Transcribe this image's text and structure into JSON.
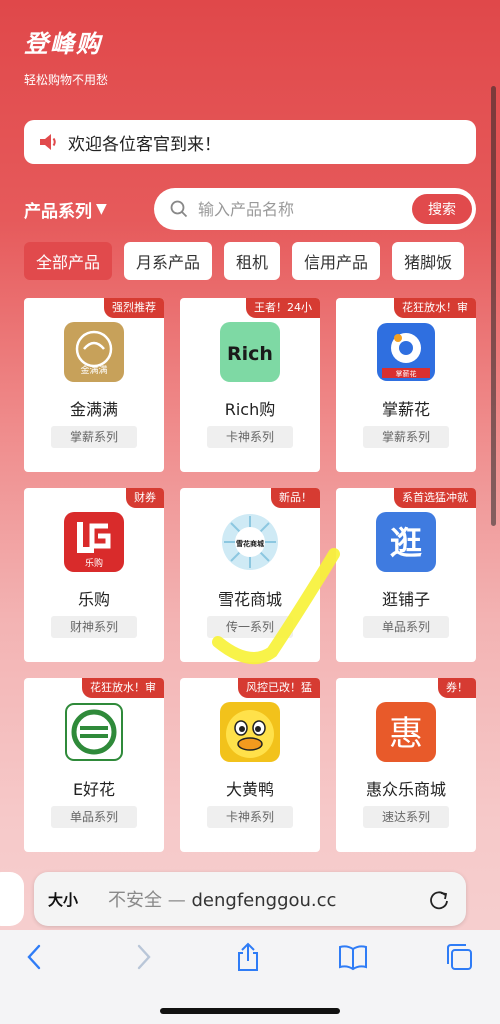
{
  "header": {
    "title": "登峰购",
    "subtitle": "轻松购物不用愁"
  },
  "notice": {
    "text": "欢迎各位客官到来！",
    "icon": "speaker-icon"
  },
  "filter": {
    "series_label": "产品系列",
    "search_placeholder": "输入产品名称",
    "search_button": "搜索"
  },
  "tabs": [
    {
      "label": "全部产品",
      "active": true
    },
    {
      "label": "月系产品",
      "active": false
    },
    {
      "label": "租机",
      "active": false
    },
    {
      "label": "信用产品",
      "active": false
    },
    {
      "label": "猪脚饭",
      "active": false
    }
  ],
  "products": [
    {
      "name": "金满满",
      "tag": "掌薪系列",
      "badge": "强烈推荐"
    },
    {
      "name": "Rich购",
      "tag": "卡神系列",
      "badge": "王者！24小"
    },
    {
      "name": "掌薪花",
      "tag": "掌薪系列",
      "badge": "花狂放水！审"
    },
    {
      "name": "乐购",
      "tag": "财神系列",
      "badge": "财券"
    },
    {
      "name": "雪花商城",
      "tag": "传一系列",
      "badge": "新品！"
    },
    {
      "name": "逛铺子",
      "tag": "单品系列",
      "badge": "系首选猛冲就"
    },
    {
      "name": "E好花",
      "tag": "单品系列",
      "badge": "花狂放水！审"
    },
    {
      "name": "大黄鸭",
      "tag": "卡神系列",
      "badge": "风控已改！猛"
    },
    {
      "name": "惠众乐商城",
      "tag": "速达系列",
      "badge": "券！"
    }
  ],
  "logos": {
    "jinmanman_text": "金满满",
    "rich_text": "Rich",
    "zhangxinhua_text": "掌薪花",
    "legou_text": "乐购",
    "xuehua_text": "雪花商城",
    "guangpuzi_text": "逛",
    "hui_text": "惠"
  },
  "browser": {
    "text_size": "大小",
    "insecure": "不安全 —",
    "domain": "dengfenggou.cc"
  },
  "colors": {
    "primary": "#e14a4c",
    "ribbon": "#d63b32"
  }
}
